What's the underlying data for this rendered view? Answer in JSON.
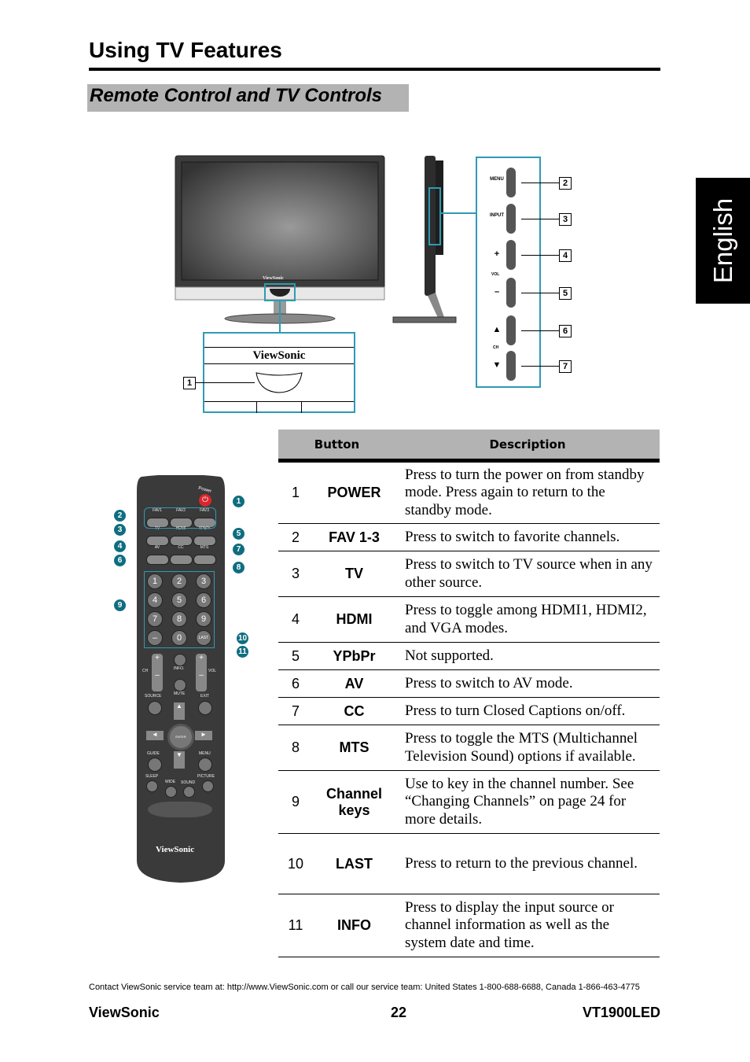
{
  "header": {
    "title": "Using TV Features",
    "section_title": "Remote Control and TV Controls",
    "language_tab": "English"
  },
  "tv_diagram": {
    "brand_label": "ViewSonic",
    "side_controls": [
      {
        "label": "MENU",
        "callout": "2"
      },
      {
        "label": "INPUT",
        "callout": "3"
      },
      {
        "label": "+",
        "callout": "4"
      },
      {
        "label": "–",
        "callout": "5"
      },
      {
        "label": "▲",
        "callout": "6"
      },
      {
        "label": "▼",
        "callout": "7"
      }
    ],
    "vol_label": "VOL",
    "ch_label": "CH",
    "power_callout": "1",
    "colors": {
      "highlight": "#2e9bb2"
    }
  },
  "remote": {
    "power_label": "Power",
    "fav": [
      "FAV1",
      "FAV2",
      "FAV3"
    ],
    "row2": [
      "TV",
      "HDMI",
      "YPbPr"
    ],
    "row3": [
      "AV",
      "CC",
      "MTS"
    ],
    "digits": [
      "1",
      "2",
      "3",
      "4",
      "5",
      "6",
      "7",
      "8",
      "9",
      "–",
      "0",
      "LAST"
    ],
    "ch_label": "CH",
    "vol_label": "VOL",
    "info_label": "INFO.",
    "mute_label": "MUTE",
    "source_label": "SOURCE",
    "exit_label": "EXIT",
    "enter_label": "ENTER",
    "guide_label": "GUIDE",
    "menu_label": "MENU",
    "sleep_label": "SLEEP",
    "wide_label": "WIDE",
    "sound_label": "SOUND",
    "picture_label": "PICTURE",
    "brand": "ViewSonic",
    "callouts": [
      "1",
      "2",
      "3",
      "4",
      "5",
      "6",
      "7",
      "8",
      "9",
      "10",
      "11"
    ],
    "colors": {
      "callout": "#0f6d80",
      "power": "#d8262c"
    }
  },
  "table": {
    "headers": [
      "Button",
      "Description"
    ],
    "rows": [
      {
        "num": "1",
        "button": "POWER",
        "desc": "Press to turn the power on from standby mode. Press again to return to the standby mode."
      },
      {
        "num": "2",
        "button": "FAV 1-3",
        "desc": "Press to switch to favorite channels."
      },
      {
        "num": "3",
        "button": "TV",
        "desc": "Press to switch to TV source when in any other source."
      },
      {
        "num": "4",
        "button": "HDMI",
        "desc": "Press to toggle among HDMI1, HDMI2, and VGA modes."
      },
      {
        "num": "5",
        "button": "YPbPr",
        "desc": "Not supported."
      },
      {
        "num": "6",
        "button": "AV",
        "desc": "Press to switch to AV mode."
      },
      {
        "num": "7",
        "button": "CC",
        "desc": "Press to turn Closed Captions on/off."
      },
      {
        "num": "8",
        "button": "MTS",
        "desc": "Press to toggle the MTS (Multichannel Television Sound) options if available."
      },
      {
        "num": "9",
        "button": "Channel keys",
        "desc": "Use to key in the channel number. See “Changing Channels” on page 24 for more details."
      },
      {
        "num": "10",
        "button": "LAST",
        "desc": "Press to return to the previous channel."
      },
      {
        "num": "11",
        "button": "INFO",
        "desc": "Press to display the input source or channel information as well as the system date and time."
      }
    ]
  },
  "footer": {
    "contact": "Contact ViewSonic service team at: http://www.ViewSonic.com or call our service team: United States 1-800-688-6688, Canada 1-866-463-4775",
    "brand": "ViewSonic",
    "page_number": "22",
    "model": "VT1900LED"
  }
}
